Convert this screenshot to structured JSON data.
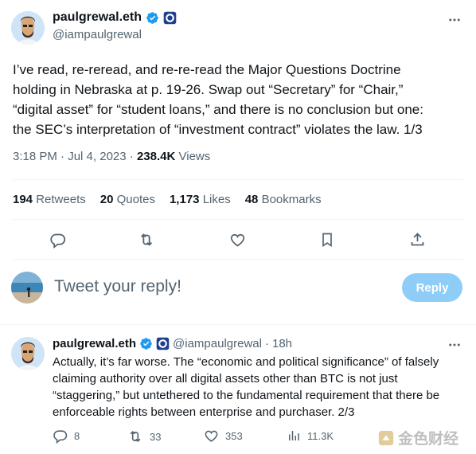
{
  "tweet": {
    "author_name": "paulgrewal.eth",
    "author_handle": "@iampaulgrewal",
    "text_lines": [
      "I’ve read, re-reread, and re-re-read the Major Questions Doctrine",
      "holding in Nebraska at p. 19-26. Swap out “Secretary” for “Chair,”",
      "“digital asset” for “student loans,” and there is no conclusion but one:",
      "the SEC’s interpretation of “investment contract” violates the law.  1/3"
    ],
    "time": "3:18 PM",
    "date": "Jul 4, 2023",
    "views_count": "238.4K",
    "views_label": "Views",
    "retweets_count": "194",
    "retweets_label": "Retweets",
    "quotes_count": "20",
    "quotes_label": "Quotes",
    "likes_count": "1,173",
    "likes_label": "Likes",
    "bookmarks_count": "48",
    "bookmarks_label": "Bookmarks"
  },
  "composer": {
    "placeholder": "Tweet your reply!",
    "reply_button": "Reply"
  },
  "reply": {
    "author_name": "paulgrewal.eth",
    "author_handle": "@iampaulgrewal",
    "time_ago": "18h",
    "text_lines": [
      "Actually, it’s far worse. The “economic and political significance” of falsely",
      "claiming authority over all digital assets other than BTC is not just",
      "“staggering,” but untethered to the fundamental requirement that there be",
      "enforceable rights between enterprise and purchaser. 2/3"
    ],
    "replies_count": "8",
    "retweets_count": "33",
    "likes_count": "353",
    "views_count": "11.3K"
  },
  "watermark": "金色财经",
  "colors": {
    "accent": "#1d9bf0",
    "reply_button_bg": "#8ecdf8",
    "muted": "#536471",
    "divider": "#eff3f4"
  }
}
